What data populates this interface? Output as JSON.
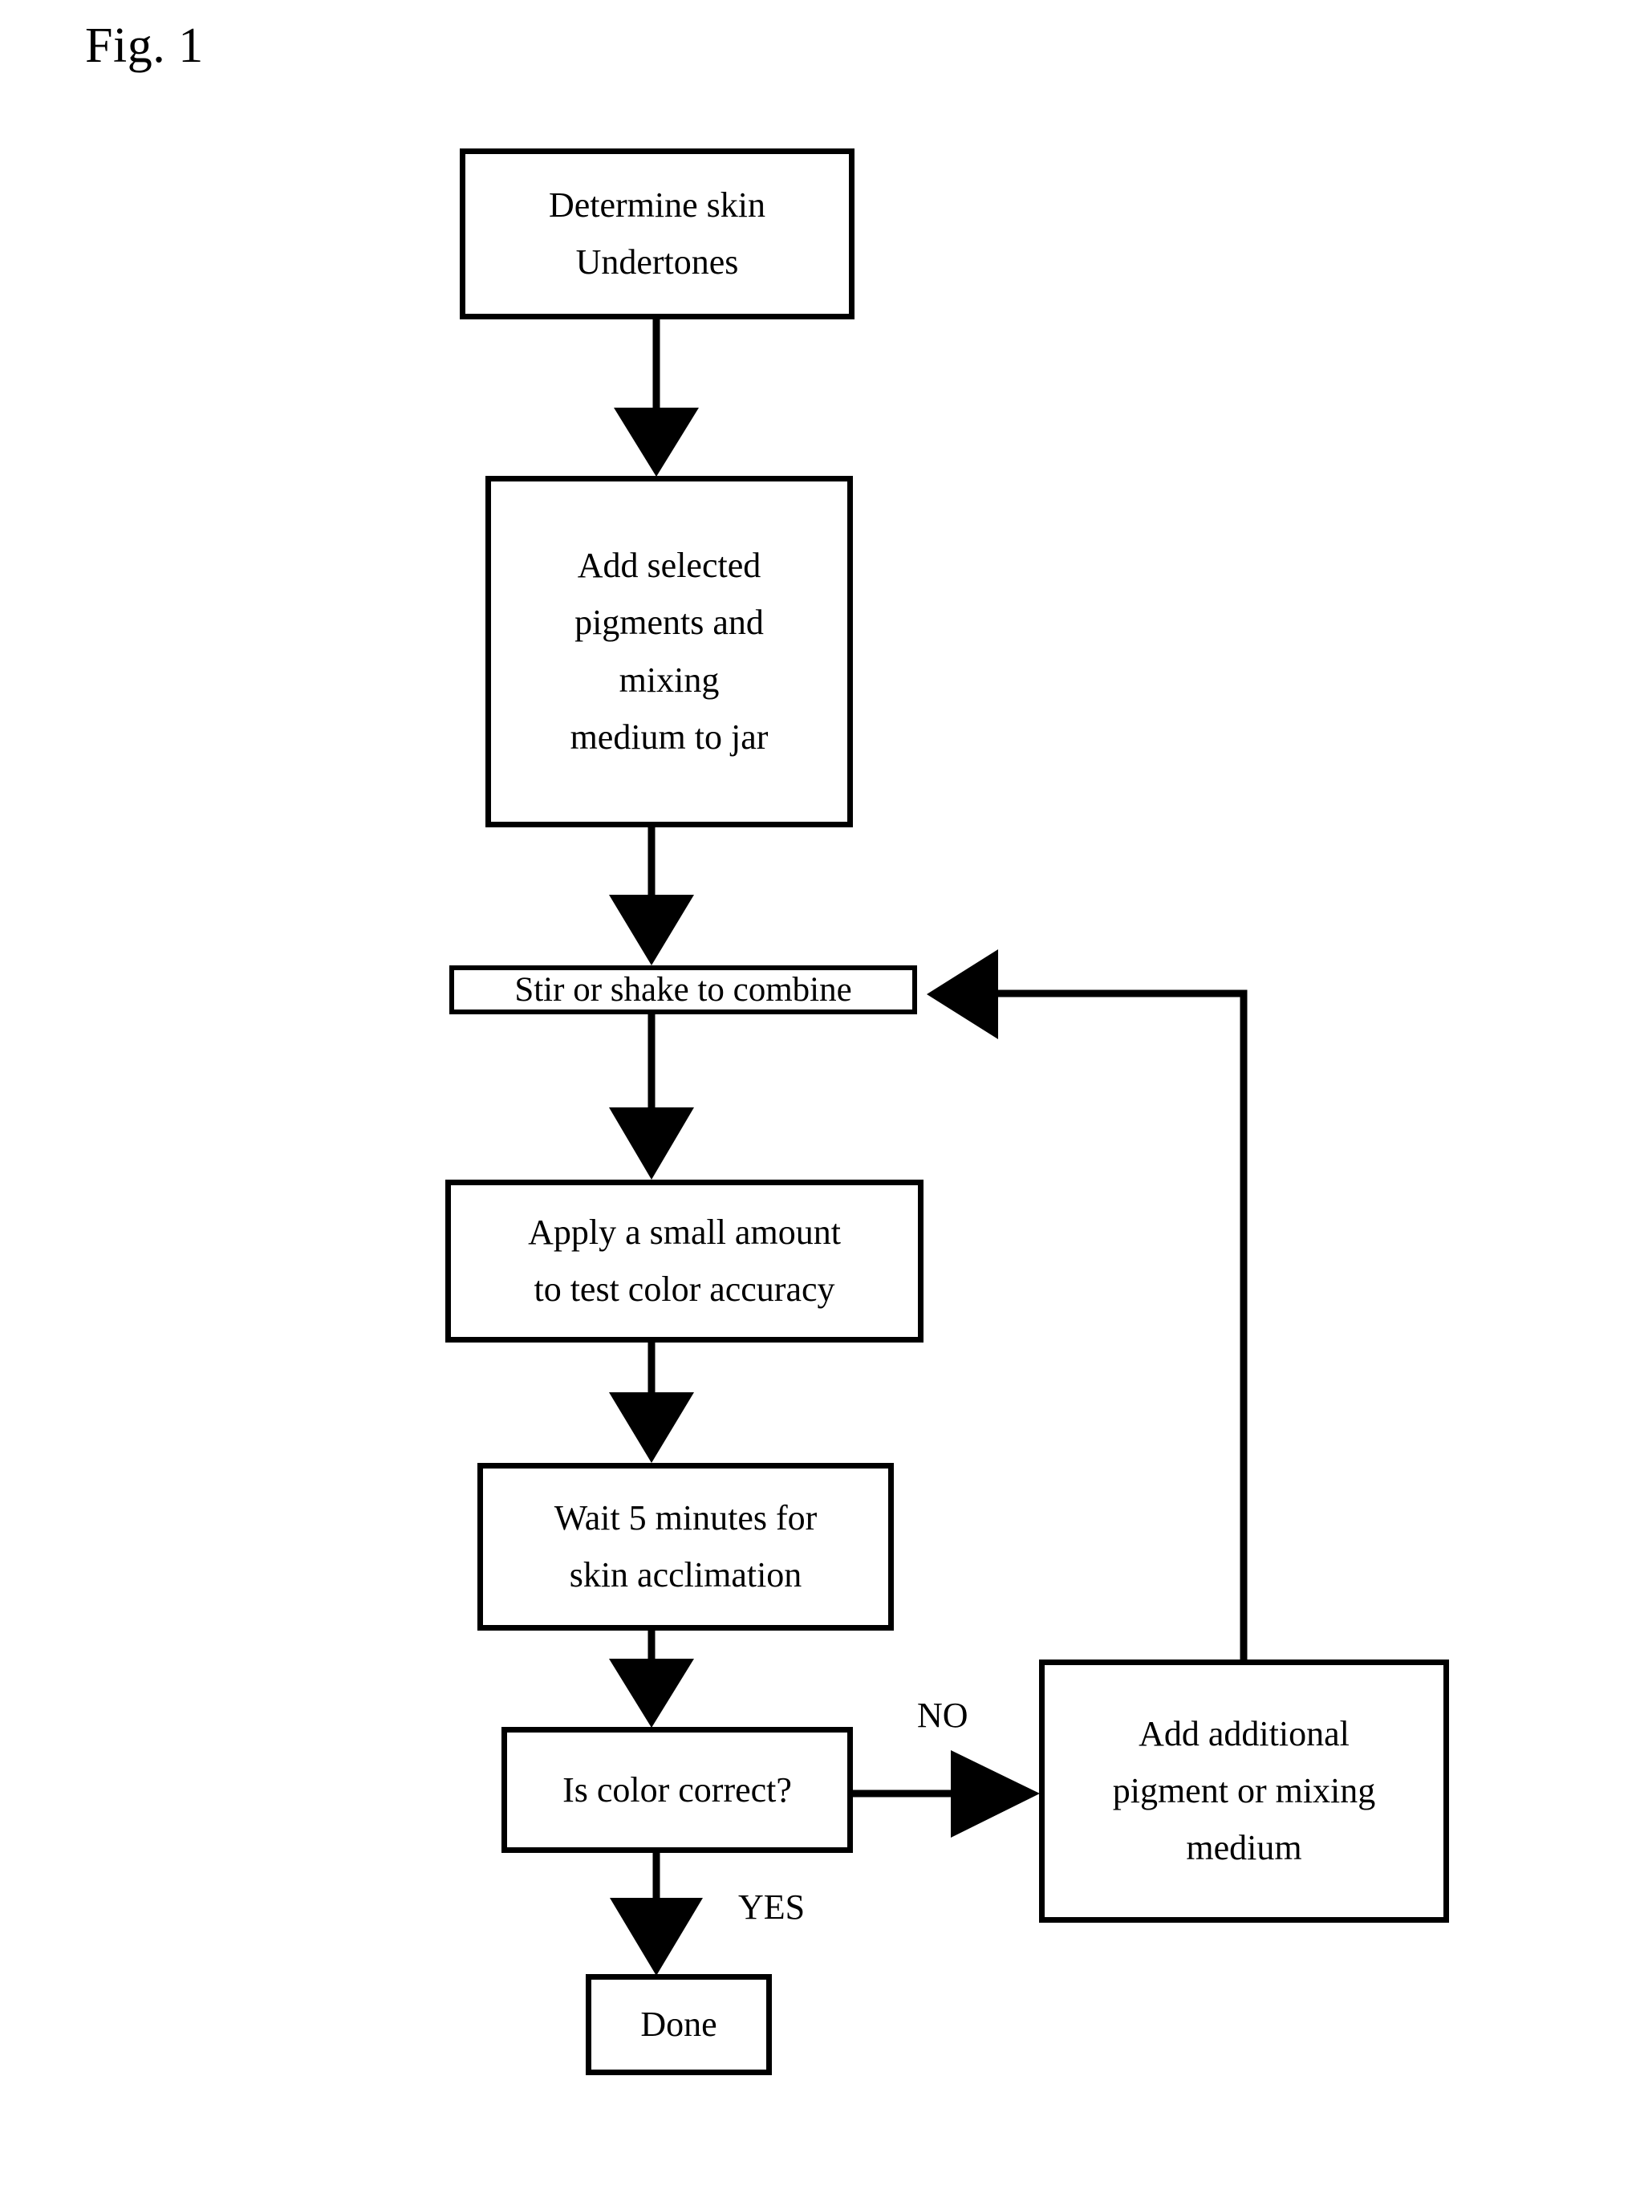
{
  "figure": {
    "label": "Fig. 1",
    "type": "flowchart",
    "background_color": "#ffffff",
    "line_color": "#000000"
  },
  "nodes": [
    {
      "id": "determine-skin-undertones",
      "lines": [
        "Determine skin",
        "Undertones"
      ],
      "shape": "rectangle"
    },
    {
      "id": "add-selected-pigments",
      "lines": [
        "Add selected",
        "pigments and",
        "mixing",
        "medium to jar"
      ],
      "shape": "rectangle"
    },
    {
      "id": "stir-or-shake",
      "lines": [
        "Stir or shake to combine"
      ],
      "shape": "rectangle"
    },
    {
      "id": "apply-small-amount",
      "lines": [
        "Apply a small amount",
        "to test color accuracy"
      ],
      "shape": "rectangle"
    },
    {
      "id": "wait-5-minutes",
      "lines": [
        "Wait 5 minutes for",
        "skin acclimation"
      ],
      "shape": "rectangle"
    },
    {
      "id": "is-color-correct",
      "lines": [
        "Is color correct?"
      ],
      "shape": "rectangle"
    },
    {
      "id": "add-additional-pigment",
      "lines": [
        "Add additional",
        "pigment or mixing",
        "medium"
      ],
      "shape": "rectangle"
    },
    {
      "id": "done",
      "lines": [
        "Done"
      ],
      "shape": "rectangle"
    }
  ],
  "edge_labels": {
    "no": "NO",
    "yes": "YES"
  }
}
